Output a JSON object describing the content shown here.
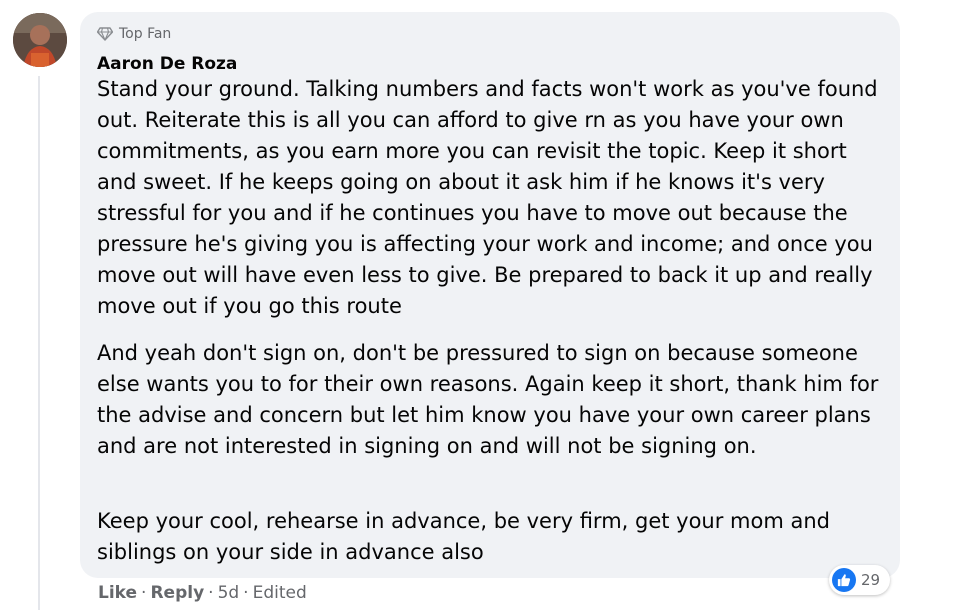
{
  "comment": {
    "badge": "Top Fan",
    "author": "Aaron De Roza",
    "paragraphs": [
      "Stand your ground. Talking numbers and facts won't work as you've found out. Reiterate this is all you can afford to give rn as you have your own commitments, as you earn more you can revisit the topic. Keep it short and sweet. If he keeps going on about it ask him if he knows it's very stressful for you and if he continues you have to move out because the pressure he's giving you is affecting your work and income; and once you move out will have even less to give. Be prepared to back it up and really move out if you go this route",
      "And yeah don't sign on, don't be pressured to sign on because someone else wants you to for their own reasons. Again keep it short, thank him for the advise and concern but let him know you have your own career plans and are not interested in signing on and will not be signing on.",
      "Keep your cool, rehearse in advance, be very firm, get your mom and siblings on your side in advance also"
    ],
    "actions": {
      "like": "Like",
      "reply": "Reply",
      "time": "5d",
      "edited": "Edited"
    },
    "reactions": {
      "icon": "like-icon",
      "count": "29"
    }
  },
  "colors": {
    "bubble": "#f0f2f5",
    "secondary_text": "#65676b",
    "primary_text": "#050505",
    "like_blue": "#1877f2"
  }
}
